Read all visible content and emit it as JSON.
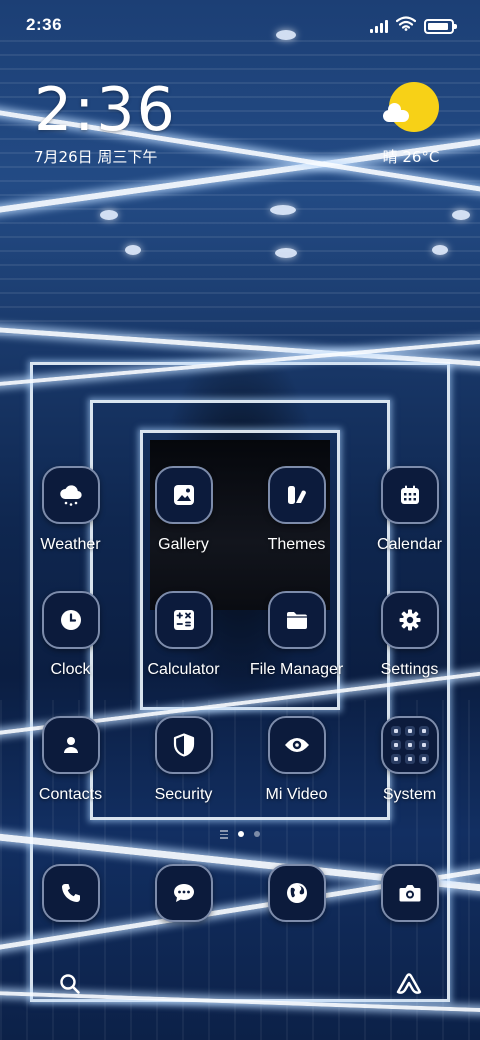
{
  "status_bar": {
    "time": "2:36",
    "icons": [
      "signal-icon",
      "wifi-icon",
      "battery-icon"
    ],
    "battery_level": 0.9
  },
  "clock_widget": {
    "time": "2:36",
    "date": "7月26日 周三下午"
  },
  "weather_widget": {
    "icon": "sunny-cloud-icon",
    "text": "晴 26°C",
    "sun_color": "#f7d117"
  },
  "apps": [
    {
      "label": "Weather",
      "icon": "weather-cloud-icon"
    },
    {
      "label": "Gallery",
      "icon": "gallery-icon"
    },
    {
      "label": "Themes",
      "icon": "themes-icon"
    },
    {
      "label": "Calendar",
      "icon": "calendar-icon"
    },
    {
      "label": "Clock",
      "icon": "clock-icon"
    },
    {
      "label": "Calculator",
      "icon": "calculator-icon"
    },
    {
      "label": "File Manager",
      "icon": "folder-icon"
    },
    {
      "label": "Settings",
      "icon": "gear-icon"
    },
    {
      "label": "Contacts",
      "icon": "contacts-icon"
    },
    {
      "label": "Security",
      "icon": "shield-icon"
    },
    {
      "label": "Mi Video",
      "icon": "eye-icon"
    },
    {
      "label": "System",
      "icon": "folder-grid-icon"
    }
  ],
  "page_indicator": {
    "pages": 2,
    "current": 1
  },
  "dock": [
    {
      "icon": "phone-icon"
    },
    {
      "icon": "message-icon"
    },
    {
      "icon": "browser-globe-icon"
    },
    {
      "icon": "camera-icon"
    }
  ],
  "bottom_bar": {
    "left_icon": "search-icon",
    "right_icon": "assistant-icon"
  },
  "colors": {
    "icon_bg": "#0c1b3c",
    "icon_border": "#7d8cab",
    "text": "#ffffff"
  }
}
